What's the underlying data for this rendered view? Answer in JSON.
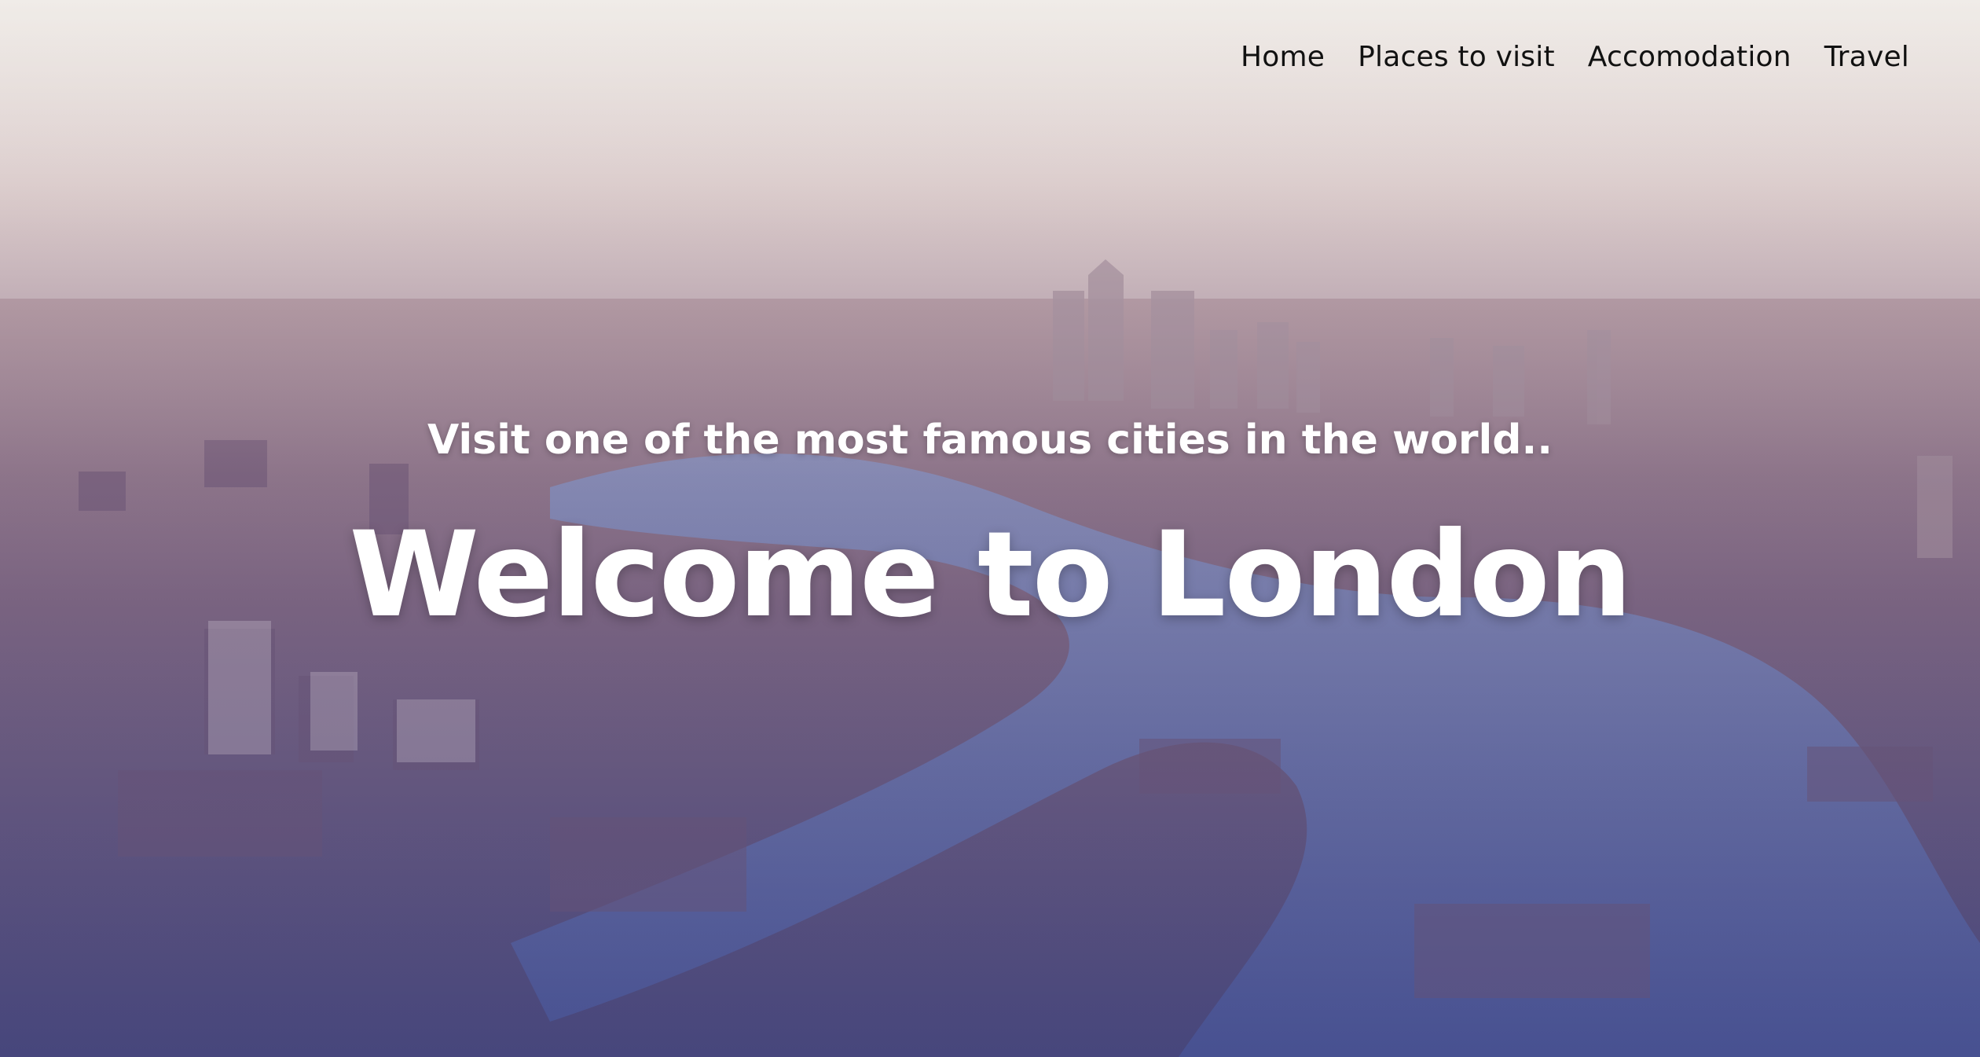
{
  "nav": {
    "items": [
      {
        "label": "Home"
      },
      {
        "label": "Places to visit"
      },
      {
        "label": "Accomodation"
      },
      {
        "label": "Travel"
      }
    ]
  },
  "hero": {
    "tagline": "Visit one of the most famous cities in the world..",
    "headline": "Welcome to London"
  },
  "colors": {
    "sky_top": "#efe9e6",
    "haze": "#c9b6bd",
    "city": "#8a6f86",
    "river": "#4d5796",
    "text": "#ffffff",
    "nav_text": "#111111"
  }
}
